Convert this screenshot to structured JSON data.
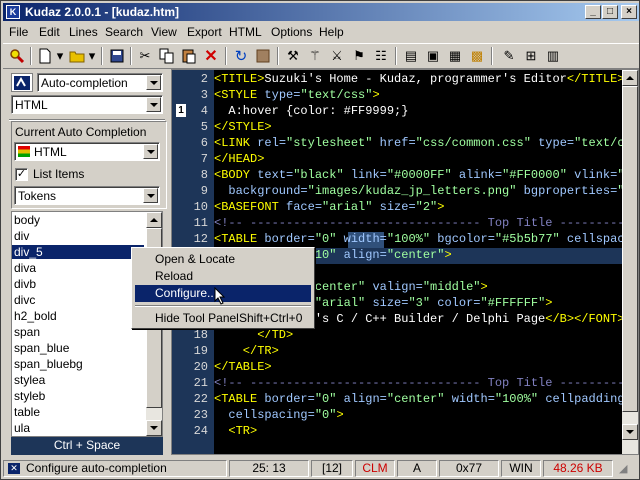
{
  "window": {
    "title": "Kudaz 2.0.0.1 - [kudaz.htm]"
  },
  "menu": [
    "File",
    "Edit",
    "Lines",
    "Search",
    "View",
    "Export",
    "HTML",
    "Options",
    "Help"
  ],
  "toolbar": {
    "icons": [
      "search-zoom-icon",
      "new-file-icon",
      "open-folder-icon",
      "save-icon",
      "cut-icon",
      "copy-icon",
      "paste-icon",
      "delete-icon",
      "undo-icon",
      "stop-icon",
      "tools-icon",
      "wand-icon",
      "filter-icon",
      "tags-icon",
      "list-icon",
      "bookmark-icon",
      "window-icon",
      "cursor-icon",
      "table-icon",
      "grid-icon",
      "frame-icon"
    ]
  },
  "panel": {
    "mode_select": "Auto-completion",
    "language_select": "HTML",
    "group_title": "Current Auto Completion",
    "completion_select": "HTML",
    "list_items_label": "List Items",
    "list_items_checked": true,
    "list_type_select": "Tokens",
    "items": [
      "body",
      "div",
      "div_5",
      "diva",
      "divb",
      "divc",
      "h2_bold",
      "span",
      "span_blue",
      "span_bluebg",
      "stylea",
      "styleb",
      "table",
      "ula"
    ],
    "selected_index": 2,
    "hint": "Ctrl + Space"
  },
  "context_menu": {
    "items": [
      "Open & Locate",
      "Reload",
      "Configure...",
      "Hide Tool Panel"
    ],
    "shortcut": "Shift+Ctrl+0",
    "selected_index": 2
  },
  "editor": {
    "bookmark": "1",
    "line_numbers": [
      "2",
      "3",
      "4",
      "5",
      "6",
      "7",
      "8",
      "9",
      "10",
      "11",
      "12",
      "13",
      "14",
      "15",
      "16",
      "17",
      "18",
      "19",
      "20",
      "21",
      "22",
      "23",
      "24"
    ],
    "lines": [
      [
        {
          "t": "<TITLE>",
          "c": "tag"
        },
        {
          "t": "Suzuki's Home - Kudaz, programmer's Editor",
          "c": "tx"
        },
        {
          "t": "</TITLE>",
          "c": "tag"
        }
      ],
      [
        {
          "t": "<STYLE ",
          "c": "tag"
        },
        {
          "t": "type=",
          "c": "at"
        },
        {
          "t": "\"text/css\"",
          "c": "st"
        },
        {
          "t": ">",
          "c": "tag"
        }
      ],
      [
        {
          "t": "  A:hover {color: #FF9999;}",
          "c": "tx"
        }
      ],
      [
        {
          "t": "</STYLE>",
          "c": "tag"
        }
      ],
      [
        {
          "t": "<LINK ",
          "c": "tag"
        },
        {
          "t": "rel=",
          "c": "at"
        },
        {
          "t": "\"stylesheet\" ",
          "c": "st"
        },
        {
          "t": "href=",
          "c": "at"
        },
        {
          "t": "\"css/common.css\" ",
          "c": "st"
        },
        {
          "t": "type=",
          "c": "at"
        },
        {
          "t": "\"text/cs",
          "c": "st"
        }
      ],
      [
        {
          "t": "</HEAD>",
          "c": "tag"
        }
      ],
      [
        {
          "t": "<BODY ",
          "c": "tag"
        },
        {
          "t": "text=",
          "c": "at"
        },
        {
          "t": "\"black\" ",
          "c": "st"
        },
        {
          "t": "link=",
          "c": "at"
        },
        {
          "t": "\"#0000FF\" ",
          "c": "st"
        },
        {
          "t": "alink=",
          "c": "at"
        },
        {
          "t": "\"#FF0000\" ",
          "c": "st"
        },
        {
          "t": "vlink=",
          "c": "at"
        },
        {
          "t": "\"#8",
          "c": "st"
        }
      ],
      [
        {
          "t": "  background=",
          "c": "at"
        },
        {
          "t": "\"images/kudaz_jp_letters.png\" ",
          "c": "st"
        },
        {
          "t": "bgproperties=",
          "c": "at"
        },
        {
          "t": "\"fi",
          "c": "st"
        }
      ],
      [
        {
          "t": "<BASEFONT ",
          "c": "tag"
        },
        {
          "t": "face=",
          "c": "at"
        },
        {
          "t": "\"arial\" ",
          "c": "st"
        },
        {
          "t": "size=",
          "c": "at"
        },
        {
          "t": "\"2\"",
          "c": "st"
        },
        {
          "t": ">",
          "c": "tag"
        }
      ],
      [
        {
          "t": "<!-- -------------------------------- Top Title ----------",
          "c": "cm"
        }
      ],
      [
        {
          "t": "<TABLE ",
          "c": "tag"
        },
        {
          "t": "border=",
          "c": "at"
        },
        {
          "t": "\"0\" ",
          "c": "st"
        },
        {
          "t": "width=",
          "c": "at"
        },
        {
          "t": "\"100%\" ",
          "c": "st"
        },
        {
          "t": "bgcolor=",
          "c": "at"
        },
        {
          "t": "\"#5b5b77\" ",
          "c": "st"
        },
        {
          "t": "cellspaci",
          "c": "at"
        }
      ],
      [
        {
          "t": "              10\" ",
          "c": "st"
        },
        {
          "t": "align=",
          "c": "at"
        },
        {
          "t": "\"center\"",
          "c": "st"
        },
        {
          "t": ">",
          "c": "tag"
        }
      ],
      [
        {
          "t": "",
          "c": "tx"
        }
      ],
      [
        {
          "t": "              center\" ",
          "c": "st"
        },
        {
          "t": "valign=",
          "c": "at"
        },
        {
          "t": "\"middle\"",
          "c": "st"
        },
        {
          "t": ">",
          "c": "tag"
        }
      ],
      [
        {
          "t": "              \"arial\" ",
          "c": "st"
        },
        {
          "t": "size=",
          "c": "at"
        },
        {
          "t": "\"3\" ",
          "c": "st"
        },
        {
          "t": "color=",
          "c": "at"
        },
        {
          "t": "\"#FFFFFF\"",
          "c": "st"
        },
        {
          "t": ">",
          "c": "tag"
        }
      ],
      [
        {
          "t": "              's C / C++ Builder / Delphi Page",
          "c": "tx"
        },
        {
          "t": "</B></FONT>",
          "c": "tag"
        }
      ],
      [
        {
          "t": "      </TD>",
          "c": "tag"
        }
      ],
      [
        {
          "t": "    </TR>",
          "c": "tag"
        }
      ],
      [
        {
          "t": "</TABLE>",
          "c": "tag"
        }
      ],
      [
        {
          "t": "<!-- -------------------------------- Top Title ----------",
          "c": "cm"
        }
      ],
      [
        {
          "t": "<TABLE ",
          "c": "tag"
        },
        {
          "t": "border=",
          "c": "at"
        },
        {
          "t": "\"0\" ",
          "c": "st"
        },
        {
          "t": "align=",
          "c": "at"
        },
        {
          "t": "\"center\" ",
          "c": "st"
        },
        {
          "t": "width=",
          "c": "at"
        },
        {
          "t": "\"100%\" ",
          "c": "st"
        },
        {
          "t": "cellpadding=",
          "c": "at"
        }
      ],
      [
        {
          "t": "  cellspacing=",
          "c": "at"
        },
        {
          "t": "\"0\"",
          "c": "st"
        },
        {
          "t": ">",
          "c": "tag"
        }
      ],
      [
        {
          "t": "  <TR>",
          "c": "tag"
        }
      ]
    ]
  },
  "status": {
    "message": "Configure auto-completion",
    "position": "25: 13",
    "column": "[12]",
    "clm": "CLM",
    "mode": "A",
    "char": "0x77",
    "eol": "WIN",
    "size": "48.26 KB"
  },
  "colors": {
    "title_start": "#0a246a",
    "title_end": "#a6caf0",
    "selection": "#0a246a",
    "editor_bg": "#000000",
    "gutter_bg": "#1d3558",
    "tag": "#ffff00",
    "attr": "#a0c8ff",
    "string": "#a0ffa0",
    "comment": "#8080c0",
    "clm": "#cc0000",
    "size": "#cc0000"
  }
}
